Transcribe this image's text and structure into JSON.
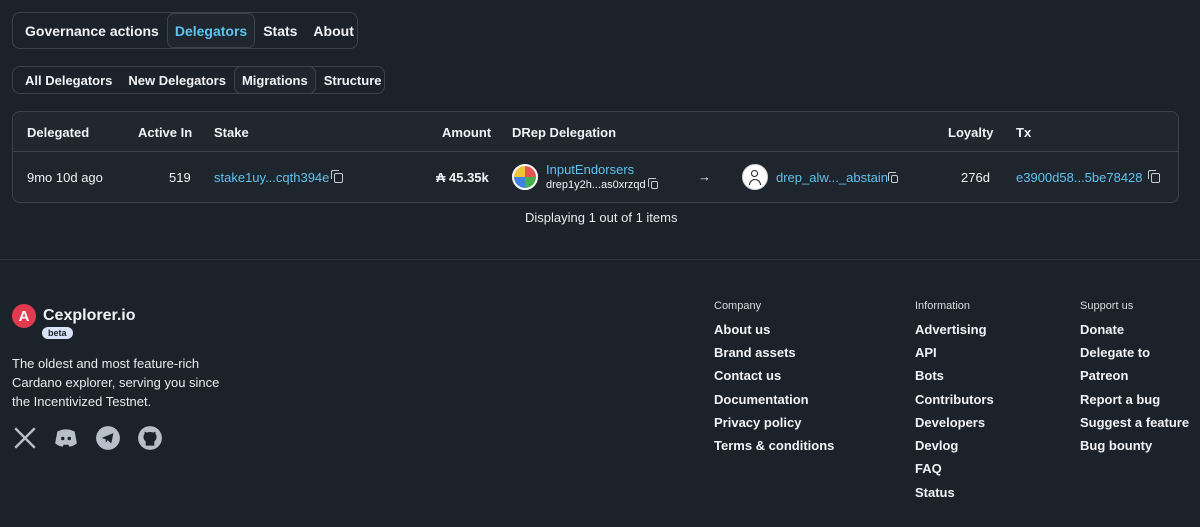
{
  "main_tabs": [
    "Governance actions",
    "Delegators",
    "Stats",
    "About"
  ],
  "sub_tabs": [
    "All Delegators",
    "New Delegators",
    "Migrations",
    "Structure"
  ],
  "table": {
    "headers": {
      "delegated": "Delegated",
      "active_in": "Active In",
      "stake": "Stake",
      "amount": "Amount",
      "drep": "DRep Delegation",
      "loyalty": "Loyalty",
      "tx": "Tx"
    },
    "row": {
      "delegated": "9mo 10d ago",
      "active_in": "519",
      "stake": "stake1uy...cqth394e",
      "amount": "₳ 45.35k",
      "from_name": "InputEndorsers",
      "from_id": "drep1y2h...as0xrzqd",
      "arrow": "→",
      "to_id": "drep_alw..._abstain",
      "loyalty": "276d",
      "tx": "e3900d58...5be78428"
    },
    "pagination": "Displaying 1 out of 1 items"
  },
  "footer": {
    "logo_letter": "A",
    "logo_text": "Cexplorer.io",
    "beta": "beta",
    "tagline": "The oldest and most feature-rich Cardano explorer, serving you since the Incentivized Testnet.",
    "columns": {
      "company": {
        "title": "Company",
        "items": [
          "About us",
          "Brand assets",
          "Contact us",
          "Documentation",
          "Privacy policy",
          "Terms & conditions"
        ]
      },
      "information": {
        "title": "Information",
        "items": [
          "Advertising",
          "API",
          "Bots",
          "Contributors",
          "Developers",
          "Devlog",
          "FAQ",
          "Status"
        ]
      },
      "support": {
        "title": "Support us",
        "items": [
          "Donate",
          "Delegate to",
          "Patreon",
          "Report a bug",
          "Suggest a feature",
          "Bug bounty"
        ]
      }
    },
    "social_icons": [
      "x-icon",
      "discord-icon",
      "telegram-icon",
      "github-icon"
    ]
  }
}
